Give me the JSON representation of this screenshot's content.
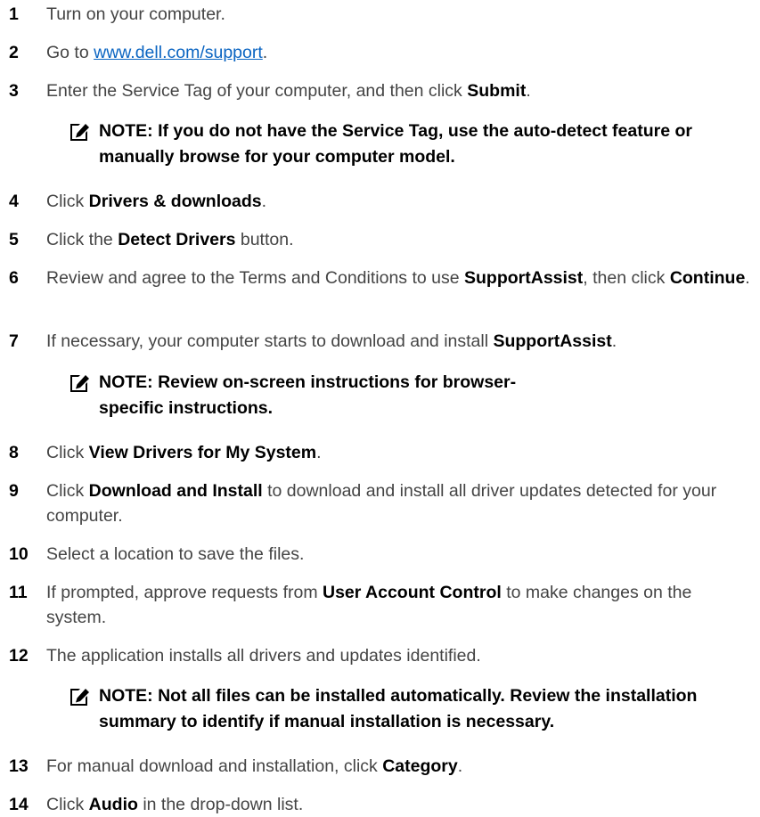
{
  "steps": [
    {
      "num": "1",
      "parts": [
        {
          "t": "Turn on your computer."
        }
      ]
    },
    {
      "num": "2",
      "parts": [
        {
          "t": "Go to "
        },
        {
          "t": "www.dell.com/support",
          "link": true
        },
        {
          "t": "."
        }
      ]
    },
    {
      "num": "3",
      "parts": [
        {
          "t": "Enter the Service Tag of your computer, and then click "
        },
        {
          "t": "Submit",
          "b": true
        },
        {
          "t": "."
        }
      ]
    },
    {
      "num": "4",
      "parts": [
        {
          "t": "Click "
        },
        {
          "t": "Drivers & downloads",
          "b": true
        },
        {
          "t": "."
        }
      ]
    },
    {
      "num": "5",
      "parts": [
        {
          "t": "Click the "
        },
        {
          "t": "Detect Drivers",
          "b": true
        },
        {
          "t": " button."
        }
      ]
    },
    {
      "num": "6",
      "parts": [
        {
          "t": "Review and agree to the Terms and Conditions to use "
        },
        {
          "t": "SupportAssist",
          "b": true
        },
        {
          "t": ", then click "
        },
        {
          "t": "Continue",
          "b": true
        },
        {
          "t": "."
        }
      ]
    },
    {
      "num": "7",
      "parts": [
        {
          "t": "If necessary, your computer starts to download and install "
        },
        {
          "t": "SupportAssist",
          "b": true
        },
        {
          "t": "."
        }
      ]
    },
    {
      "num": "8",
      "parts": [
        {
          "t": "Click "
        },
        {
          "t": "View Drivers for My System",
          "b": true
        },
        {
          "t": "."
        }
      ]
    },
    {
      "num": "9",
      "parts": [
        {
          "t": "Click "
        },
        {
          "t": "Download and Install",
          "b": true
        },
        {
          "t": " to download and install all driver updates detected for your computer."
        }
      ]
    },
    {
      "num": "10",
      "parts": [
        {
          "t": "Select a location to save the files."
        }
      ]
    },
    {
      "num": "11",
      "parts": [
        {
          "t": "If prompted, approve requests from "
        },
        {
          "t": "User Account Control",
          "b": true
        },
        {
          "t": " to make changes on the system."
        }
      ]
    },
    {
      "num": "12",
      "parts": [
        {
          "t": "The application installs all drivers and updates identified."
        }
      ]
    },
    {
      "num": "13",
      "parts": [
        {
          "t": "For manual download and installation, click "
        },
        {
          "t": "Category",
          "b": true
        },
        {
          "t": "."
        }
      ]
    },
    {
      "num": "14",
      "parts": [
        {
          "t": "Click "
        },
        {
          "t": "Audio",
          "b": true
        },
        {
          "t": " in the drop-down list."
        }
      ]
    }
  ],
  "notes": [
    {
      "text": "NOTE: If you do not have the Service Tag, use the auto-detect feature or manually browse for your computer model.",
      "icon": "pencil-icon"
    },
    {
      "text": "NOTE: Review on-screen instructions for browser-specific instructions.",
      "icon": "pencil-icon"
    },
    {
      "text": "NOTE: Not all files can be installed automatically. Review the installation summary to identify if manual installation is necessary.",
      "icon": "pencil-icon"
    }
  ],
  "colors": {
    "link": "#0b65c2",
    "text": "#444444",
    "bold": "#000000"
  }
}
